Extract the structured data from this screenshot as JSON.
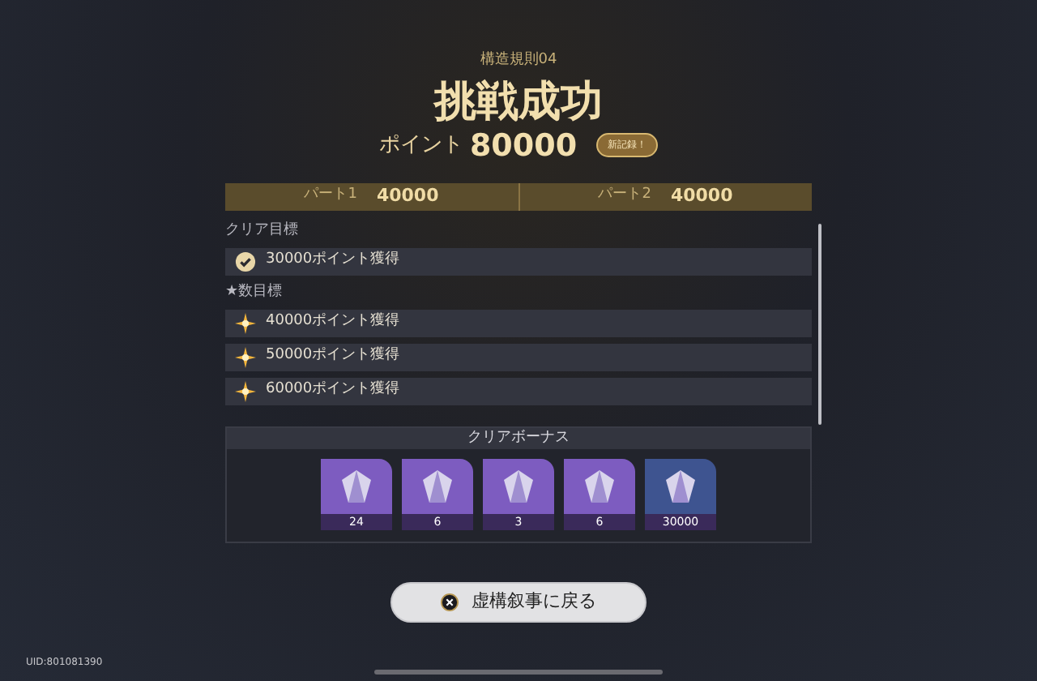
{
  "header": {
    "subtitle": "構造規則04",
    "title": "挑戦成功",
    "points_label": "ポイント",
    "points": "80000",
    "badge": "新記録！"
  },
  "parts": [
    {
      "label": "パート1",
      "value": "40000"
    },
    {
      "label": "パート2",
      "value": "40000"
    }
  ],
  "sections": [
    {
      "heading": "クリア目標",
      "goals": [
        {
          "kind": "check",
          "text": "30000ポイント獲得"
        }
      ]
    },
    {
      "heading": "★数目標",
      "goals": [
        {
          "kind": "star",
          "text": "40000ポイント獲得"
        },
        {
          "kind": "star",
          "text": "50000ポイント獲得"
        },
        {
          "kind": "star",
          "text": "60000ポイント獲得"
        }
      ]
    }
  ],
  "rewards": {
    "title": "クリアボーナス",
    "items": [
      {
        "count": "24",
        "color": "#7d5cc0"
      },
      {
        "count": "6",
        "color": "#7d5cc0"
      },
      {
        "count": "3",
        "color": "#7d5cc0"
      },
      {
        "count": "6",
        "color": "#7d5cc0"
      },
      {
        "count": "30000",
        "color": "#3e5490"
      }
    ]
  },
  "back_button": {
    "label": "虚構叙事に戻る"
  },
  "uid": "UID:801081390"
}
